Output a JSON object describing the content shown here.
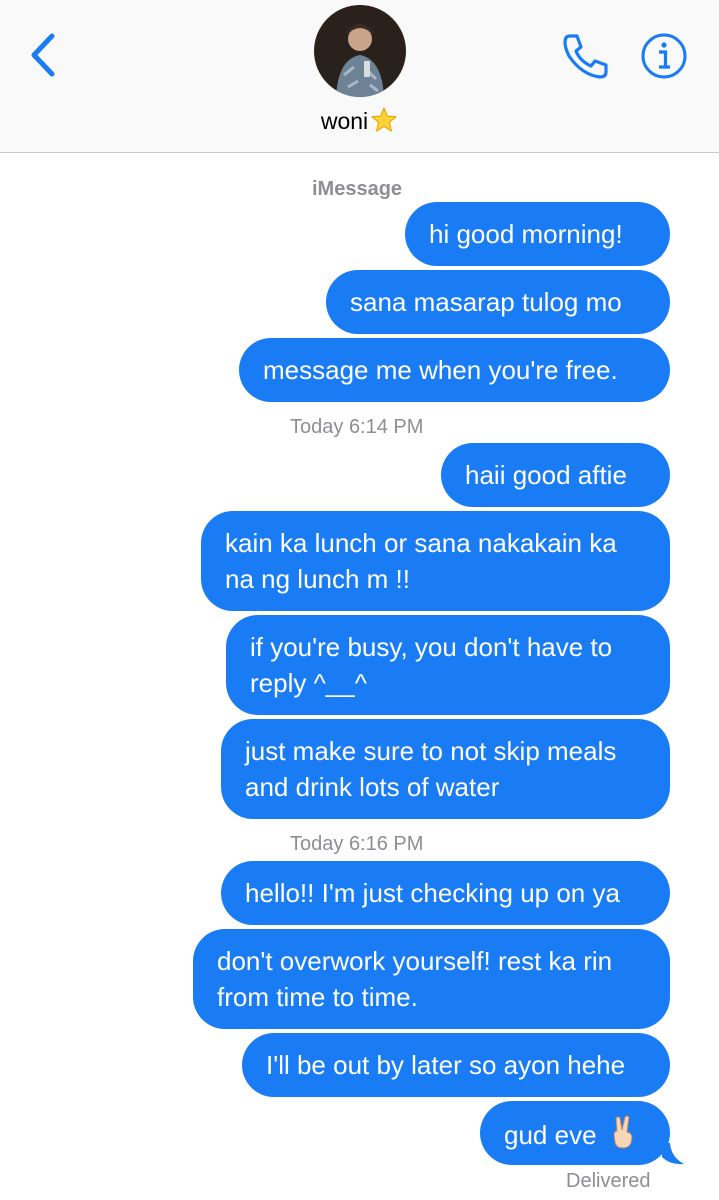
{
  "header": {
    "contact_name": "woni",
    "back_icon": "chevron-left-icon",
    "call_icon": "phone-icon",
    "info_icon": "info-icon",
    "accent_color": "#1a7cf5"
  },
  "service_label": "iMessage",
  "timestamps": [
    {
      "day": "Today",
      "time": "6:14 PM"
    },
    {
      "day": "Today",
      "time": "6:16 PM"
    }
  ],
  "messages": [
    {
      "text": "hi good morning!"
    },
    {
      "text": "sana masarap tulog mo"
    },
    {
      "text": "message me when you're free."
    },
    {
      "text": "haii good aftie"
    },
    {
      "lines": [
        "kain ka lunch or sana nakakain ka",
        "na ng lunch m !!"
      ]
    },
    {
      "lines": [
        "if you're busy, you don't have to",
        "reply ^__^"
      ]
    },
    {
      "lines": [
        "just make sure to not skip meals",
        "and drink lots of water"
      ]
    },
    {
      "text": "hello!! I'm just checking up on ya"
    },
    {
      "lines": [
        "don't overwork yourself! rest ka rin",
        "from time to time."
      ]
    },
    {
      "text": "I'll be out by later so ayon hehe"
    },
    {
      "text": "gud eve",
      "emoji": "victory-hand-emoji"
    }
  ],
  "status": "Delivered"
}
